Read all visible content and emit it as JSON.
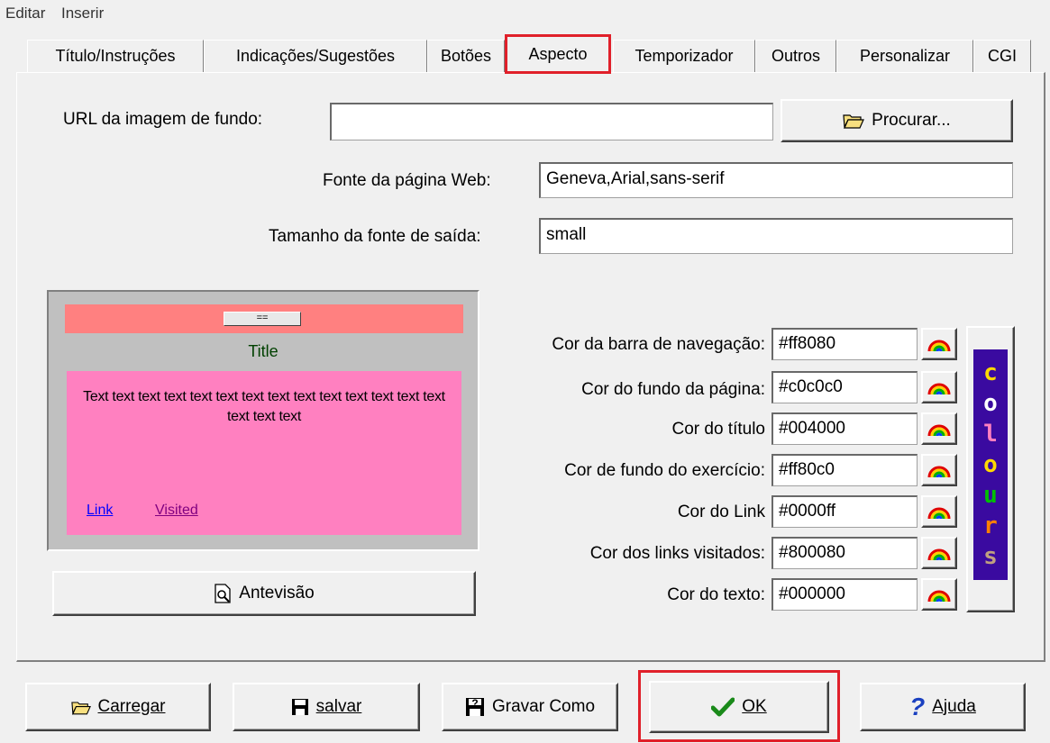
{
  "menu": {
    "items": [
      "Editar",
      "Inserir"
    ]
  },
  "tabs": [
    "Título/Instruções",
    "Indicações/Sugestões",
    "Botões",
    "Aspecto",
    "Temporizador",
    "Outros",
    "Personalizar",
    "CGI"
  ],
  "active_tab": "Aspecto",
  "background": {
    "url_label": "URL da imagem de fundo:",
    "url_value": "",
    "browse_label": "Procurar..."
  },
  "font": {
    "web_font_label": "Fonte da página Web:",
    "web_font_value": "Geneva,Arial,sans-serif",
    "size_label": "Tamanho da fonte de saída:",
    "size_value": "small"
  },
  "preview": {
    "nav_button": "==",
    "title": "Title",
    "body_text": "Text text text text text text text text text text text text text text text text text",
    "link": "Link",
    "visited": "Visited",
    "preview_button": "Antevisão"
  },
  "colors": [
    {
      "label": "Cor da barra de navegação:",
      "value": "#ff8080"
    },
    {
      "label": "Cor do fundo da página:",
      "value": "#c0c0c0"
    },
    {
      "label": "Cor do título",
      "value": "#004000"
    },
    {
      "label": "Cor de fundo do exercício:",
      "value": "#ff80c0"
    },
    {
      "label": "Cor do Link",
      "value": "#0000ff"
    },
    {
      "label": "Cor dos links visitados:",
      "value": "#800080"
    },
    {
      "label": "Cor do texto:",
      "value": "#000000"
    }
  ],
  "colours_logo": "colours",
  "footer": {
    "load": "Carregar",
    "save": "salvar",
    "save_as": "Gravar Como",
    "ok": "OK",
    "help": "Ajuda"
  },
  "accent_colors": {
    "highlight": "#e0202a",
    "nav_bar": "#ff8080",
    "page_bg": "#c0c0c0",
    "title": "#004000",
    "exercise_bg": "#ff80c0",
    "link": "#0000ff",
    "visited": "#800080"
  }
}
